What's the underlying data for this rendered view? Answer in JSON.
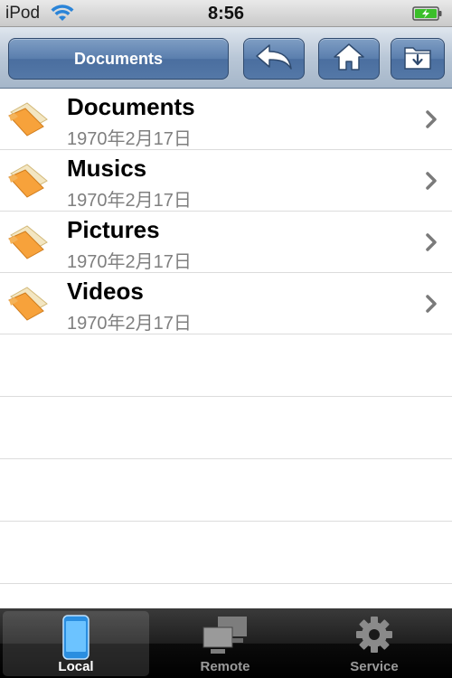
{
  "status_bar": {
    "carrier": "iPod",
    "time": "8:56"
  },
  "nav": {
    "title": "Documents"
  },
  "list": [
    {
      "title": "Documents",
      "date": "1970年2月17日"
    },
    {
      "title": "Musics",
      "date": "1970年2月17日"
    },
    {
      "title": "Pictures",
      "date": "1970年2月17日"
    },
    {
      "title": "Videos",
      "date": "1970年2月17日"
    }
  ],
  "tabs": [
    {
      "label": "Local",
      "icon": "phone-icon",
      "selected": true
    },
    {
      "label": "Remote",
      "icon": "computers-icon",
      "selected": false
    },
    {
      "label": "Service",
      "icon": "gear-icon",
      "selected": false
    }
  ],
  "colors": {
    "nav_button": "#5a7ead",
    "folder": "#f5a03a",
    "tab_selected_icon": "#3aa6f0"
  }
}
